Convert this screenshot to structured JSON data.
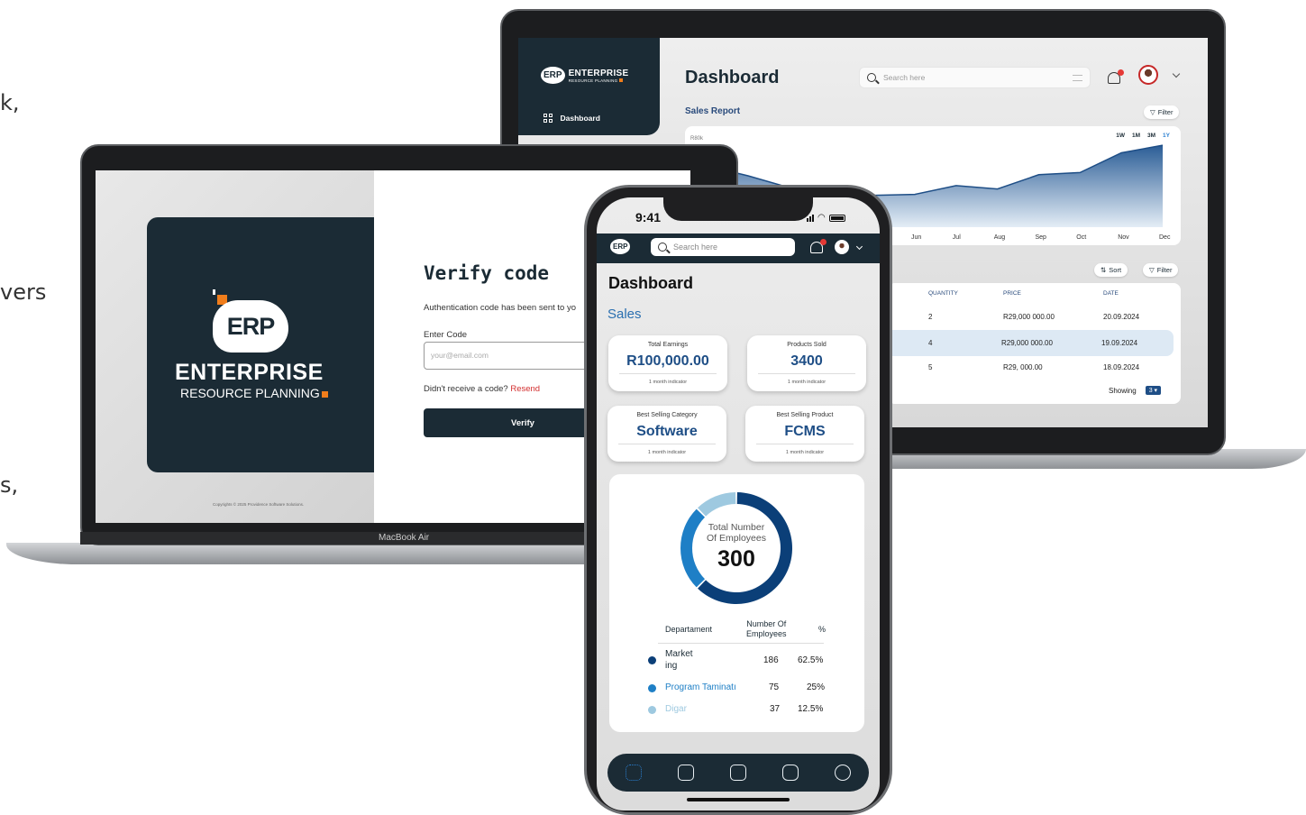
{
  "marketing": {
    "fragments": [
      "k,",
      "vers",
      "s,"
    ]
  },
  "brand": {
    "logo_mark": "ERP",
    "name_line1": "ENTERPRISE",
    "name_line2": "RESOURCE PLANNING",
    "accent": "#f07d1b",
    "primary": "#1b2b35"
  },
  "dashboard": {
    "sidebar_item": "Dashboard",
    "title": "Dashboard",
    "search_placeholder": "Search here",
    "sales_report": "Sales Report",
    "filter_label": "Filter",
    "sort_label": "Sort",
    "ranges": [
      "1W",
      "1M",
      "3M",
      "1Y"
    ],
    "active_range": "1Y",
    "chart_data": {
      "type": "area",
      "title": "Sales Report",
      "x": [
        "Jun",
        "Jul",
        "Aug",
        "Sep",
        "Oct",
        "Nov",
        "Dec"
      ],
      "ytick_top": "R80k",
      "values": [
        30,
        38,
        35,
        48,
        50,
        68,
        75
      ]
    },
    "table": {
      "columns": [
        "QUANTITY",
        "PRICE",
        "DATE"
      ],
      "rows": [
        [
          "2",
          "R29,000 000.00",
          "20.09.2024"
        ],
        [
          "4",
          "R29,000 000.00",
          "19.09.2024"
        ],
        [
          "5",
          "R29, 000.00",
          "18.09.2024"
        ]
      ],
      "showing_label": "Showing",
      "showing_value": "3"
    }
  },
  "verify": {
    "title": "Verify code",
    "auth_text": "Authentication code has been sent to yo",
    "code_label": "Enter Code",
    "code_placeholder": "your@email.com",
    "resend_prompt": "Didn't receive a code?",
    "resend_link": "Resend",
    "button": "Verify",
    "copyright": "Copyrights © 2025 Providence Software Solutions.",
    "device_label": "MacBook Air"
  },
  "phone": {
    "time": "9:41",
    "search_placeholder": "Search here",
    "title": "Dashboard",
    "section": "Sales",
    "kpis": [
      {
        "label": "Total Earnings",
        "value": "R100,000.00",
        "indicator": "1 month indicator"
      },
      {
        "label": "Products Sold",
        "value": "3400",
        "indicator": "1 month indicator"
      },
      {
        "label": "Best Selling Category",
        "value": "Software",
        "indicator": "1 month indicator"
      },
      {
        "label": "Best Selling Product",
        "value": "FCMS",
        "indicator": "1 month indicator"
      }
    ],
    "donut": {
      "label": "Total Number Of Employees",
      "label_line1": "Total Number",
      "label_line2": "Of Employees",
      "total": "300",
      "headers": {
        "dept": "Departament",
        "num_line1": "Number Of",
        "num_line2": "Employees",
        "pct": "%"
      },
      "chart_data": {
        "type": "pie",
        "categories": [
          "Market ing",
          "Program Taminati",
          "Digar"
        ],
        "values": [
          186,
          75,
          37
        ],
        "percents": [
          "62.5%",
          "25%",
          "12.5%"
        ],
        "colors": [
          "#0b3f78",
          "#1e7fc6",
          "#9ec9e0"
        ]
      },
      "rows": [
        {
          "name_line1": "Market",
          "name_line2": "ing",
          "count": "186",
          "pct": "62.5%",
          "color": "#0b3f78"
        },
        {
          "name_line1": "Program Taminatı",
          "name_line2": "",
          "count": "75",
          "pct": "25%",
          "color": "#1e7fc6"
        },
        {
          "name_line1": "Digar",
          "name_line2": "",
          "count": "37",
          "pct": "12.5%",
          "color": "#9ec9e0"
        }
      ]
    },
    "tabs": [
      "dashboard-icon",
      "crm-icon",
      "reports-icon",
      "profile-icon",
      "inventory-icon"
    ]
  }
}
